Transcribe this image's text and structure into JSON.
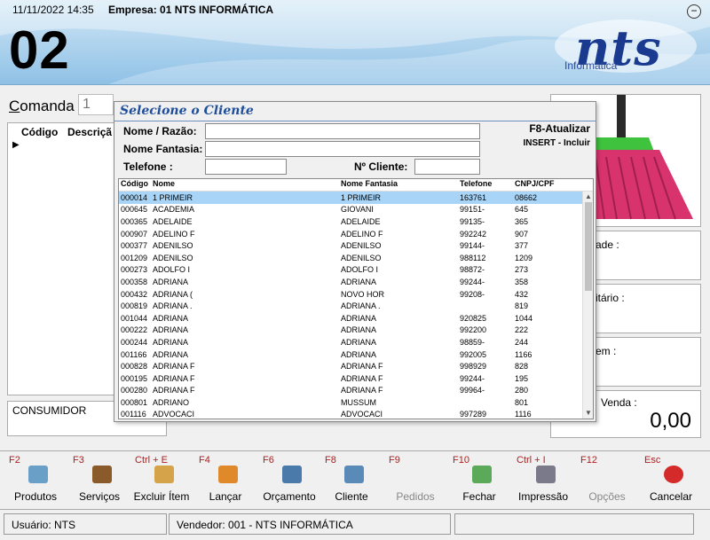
{
  "header": {
    "datetime": "11/11/2022 14:35",
    "empresa": "Empresa: 01 NTS INFORMÁTICA",
    "comanda_number": "02",
    "minimize_symbol": "−",
    "logo_main": "nts",
    "logo_sub": "Informática"
  },
  "main": {
    "comanda_label_first": "C",
    "comanda_label_rest": "omanda",
    "comanda_value": "1",
    "grid_col_codigo": "Código",
    "grid_col_descricao": "Descriçã",
    "grid_pointer": "▶",
    "consumer_label": "CONSUMIDOR"
  },
  "right_panels": {
    "p1_label": "ade :",
    "p2_label": "itário :",
    "p3_label": "em :",
    "venda_label": "Venda :",
    "venda_value": "0,00"
  },
  "dialog": {
    "title": "Selecione o Cliente",
    "label_nome_razao": "Nome / Razão:",
    "label_nome_fantasia": "Nome Fantasia:",
    "label_telefone": "Telefone :",
    "label_n_cliente": "Nº Cliente:",
    "hint_f8": "F8-Atualizar",
    "hint_insert": "INSERT - Incluir",
    "columns": [
      "Código",
      "Nome",
      "Nome Fantasia",
      "Telefone",
      "CNPJ/CPF"
    ],
    "rows": [
      {
        "codigo": "000014",
        "nome": "1 PRIMEIR",
        "fantasia": "1 PRIMEIR",
        "telefone": "163761",
        "cnpj": "08662",
        "selected": true
      },
      {
        "codigo": "000645",
        "nome": "ACADEMIA",
        "fantasia": "GIOVANI",
        "telefone": "99151-",
        "cnpj": "645"
      },
      {
        "codigo": "000365",
        "nome": "ADELAIDE",
        "fantasia": "ADELAIDE",
        "telefone": "99135-",
        "cnpj": "365"
      },
      {
        "codigo": "000907",
        "nome": "ADELINO F",
        "fantasia": "ADELINO F",
        "telefone": "992242",
        "cnpj": "907"
      },
      {
        "codigo": "000377",
        "nome": "ADENILSO",
        "fantasia": "ADENILSO",
        "telefone": "99144-",
        "cnpj": "377"
      },
      {
        "codigo": "001209",
        "nome": "ADENILSO",
        "fantasia": "ADENILSO",
        "telefone": "988112",
        "cnpj": "1209"
      },
      {
        "codigo": "000273",
        "nome": "ADOLFO I",
        "fantasia": "ADOLFO I",
        "telefone": "98872-",
        "cnpj": "273"
      },
      {
        "codigo": "000358",
        "nome": "ADRIANA",
        "fantasia": "ADRIANA",
        "telefone": "99244-",
        "cnpj": "358"
      },
      {
        "codigo": "000432",
        "nome": "ADRIANA (",
        "fantasia": "NOVO HOR",
        "telefone": "99208-",
        "cnpj": "432"
      },
      {
        "codigo": "000819",
        "nome": "ADRIANA .",
        "fantasia": "ADRIANA .",
        "telefone": "",
        "cnpj": "819"
      },
      {
        "codigo": "001044",
        "nome": "ADRIANA",
        "fantasia": "ADRIANA",
        "telefone": "920825",
        "cnpj": "1044"
      },
      {
        "codigo": "000222",
        "nome": "ADRIANA",
        "fantasia": "ADRIANA",
        "telefone": "992200",
        "cnpj": "222"
      },
      {
        "codigo": "000244",
        "nome": "ADRIANA",
        "fantasia": "ADRIANA",
        "telefone": "98859-",
        "cnpj": "244"
      },
      {
        "codigo": "001166",
        "nome": "ADRIANA",
        "fantasia": "ADRIANA",
        "telefone": "992005",
        "cnpj": "1166"
      },
      {
        "codigo": "000828",
        "nome": "ADRIANA F",
        "fantasia": "ADRIANA F",
        "telefone": "998929",
        "cnpj": "828"
      },
      {
        "codigo": "000195",
        "nome": "ADRIANA F",
        "fantasia": "ADRIANA F",
        "telefone": "99244-",
        "cnpj": "195"
      },
      {
        "codigo": "000280",
        "nome": "ADRIANA F",
        "fantasia": "ADRIANA F",
        "telefone": "99964-",
        "cnpj": "280"
      },
      {
        "codigo": "000801",
        "nome": "ADRIANO",
        "fantasia": "MUSSUM",
        "telefone": "",
        "cnpj": "801"
      },
      {
        "codigo": "001116",
        "nome": "ADVOCACI",
        "fantasia": "ADVOCACI",
        "telefone": "997289",
        "cnpj": "1116"
      }
    ]
  },
  "toolbar": {
    "buttons": [
      {
        "key": "F2",
        "label": "Produtos",
        "icon": "products-icon",
        "color": "#6aa0c8",
        "disabled": false
      },
      {
        "key": "F3",
        "label": "Serviços",
        "icon": "services-icon",
        "color": "#8a5a2a",
        "disabled": false
      },
      {
        "key": "Ctrl + E",
        "label": "Excluir Ítem",
        "icon": "delete-item-icon",
        "color": "#d4a34a",
        "disabled": false
      },
      {
        "key": "F4",
        "label": "Lançar",
        "icon": "percent-icon",
        "color": "#e0892a",
        "disabled": false
      },
      {
        "key": "F6",
        "label": "Orçamento",
        "icon": "calculator-icon",
        "color": "#4a7aaa",
        "disabled": false
      },
      {
        "key": "F8",
        "label": "Cliente",
        "icon": "client-card-icon",
        "color": "#5a8ab8",
        "disabled": false
      },
      {
        "key": "F9",
        "label": "Pedidos",
        "icon": "orders-icon",
        "color": "#f0f0f0",
        "disabled": true
      },
      {
        "key": "F10",
        "label": "Fechar",
        "icon": "money-icon",
        "color": "#5aaa5a",
        "disabled": false
      },
      {
        "key": "Ctrl + I",
        "label": "Impressão",
        "icon": "printer-icon",
        "color": "#7a7a8a",
        "disabled": false
      },
      {
        "key": "F12",
        "label": "Opções",
        "icon": "options-icon",
        "color": "#f0f0f0",
        "disabled": true
      },
      {
        "key": "Esc",
        "label": "Cancelar",
        "icon": "cancel-icon",
        "color": "#d42a2a",
        "disabled": false
      }
    ]
  },
  "status": {
    "usuario": "Usuário: NTS",
    "vendedor": "Vendedor: 001 - NTS INFORMÁTICA"
  },
  "colors": {
    "accent": "#1f4f9a",
    "selection": "#a7d4f7",
    "hotkey": "#b01d1d"
  }
}
